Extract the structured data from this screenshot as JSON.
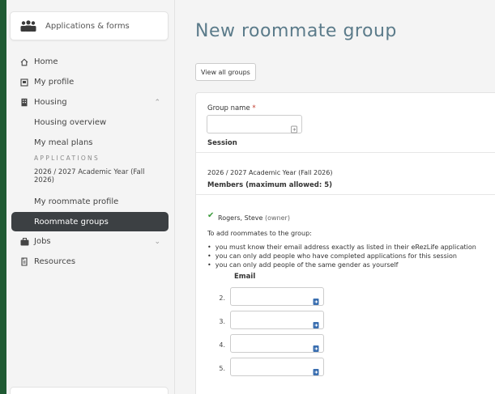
{
  "app": {
    "title": "Applications & forms"
  },
  "nav": {
    "home": "Home",
    "profile": "My profile",
    "housing": "Housing",
    "housing_overview": "Housing overview",
    "meal_plans": "My meal plans",
    "applications_caption": "APPLICATIONS",
    "academic_year": "2026 / 2027 Academic Year (Fall 2026)",
    "roommate_profile": "My roommate profile",
    "roommate_groups": "Roommate groups",
    "jobs": "Jobs",
    "resources": "Resources"
  },
  "page": {
    "title": "New roommate group",
    "view_all_button": "View all groups"
  },
  "form": {
    "group_name_label": "Group name",
    "required_mark": "*",
    "group_name_value": "",
    "session_label": "Session",
    "session_value": "2026 / 2027 Academic Year (Fall 2026)",
    "members_label": "Members (maximum allowed: 5)",
    "owner_name": "Rogers, Steve",
    "owner_tag": "(owner)",
    "add_instructions": "To add roommates to the group:",
    "rules": [
      "you must know their email address exactly as listed in their eRezLife application",
      "you can only add people who have completed applications for this session",
      "you can only add people of the same gender as yourself"
    ],
    "email_header": "Email",
    "email_rows": [
      {
        "num": "2.",
        "value": ""
      },
      {
        "num": "3.",
        "value": ""
      },
      {
        "num": "4.",
        "value": ""
      },
      {
        "num": "5.",
        "value": ""
      }
    ]
  },
  "colors": {
    "title_color": "#5b7b8a",
    "active_nav_bg": "#3c4043",
    "check_green": "#3b9a3b",
    "required_red": "#c0392b",
    "frame_bg": "#1f5a33"
  }
}
